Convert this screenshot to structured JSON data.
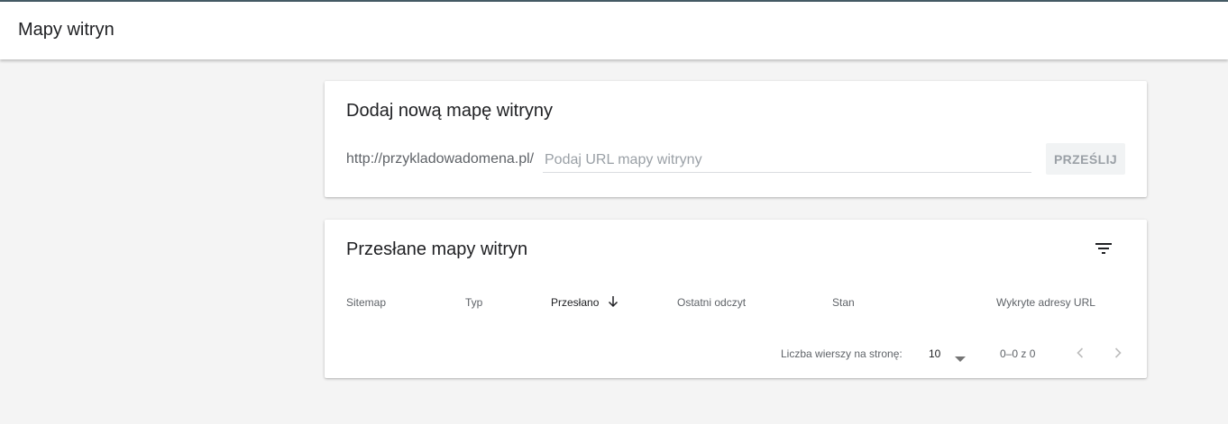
{
  "header": {
    "title": "Mapy witryn"
  },
  "add_card": {
    "title": "Dodaj nową mapę witryny",
    "prefix": "http://przykladowadomena.pl/",
    "input_placeholder": "Podaj URL mapy witryny",
    "input_value": "",
    "submit_label": "PRZEŚLIJ"
  },
  "list_card": {
    "title": "Przesłane mapy witryn",
    "filter_icon": "filter-list-icon",
    "columns": [
      "Sitemap",
      "Typ",
      "Przesłano",
      "Ostatni odczyt",
      "Stan",
      "Wykryte adresy URL"
    ],
    "sorted_column": "Przesłano",
    "sort_icon": "arrow-down-icon",
    "pagination": {
      "rows_label": "Liczba wierszy na stronę:",
      "rows_value": "10",
      "range": "0–0 z 0",
      "prev_icon": "chevron-left-icon",
      "next_icon": "chevron-right-icon"
    }
  },
  "colors": {
    "top_line": "#455a64",
    "background": "#f4f4f4",
    "card": "#ffffff",
    "muted_text": "#5f6368",
    "disabled": "#9aa0a6"
  }
}
